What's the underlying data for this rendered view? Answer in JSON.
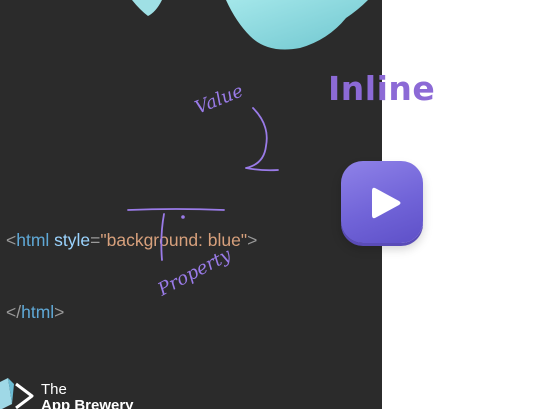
{
  "slide": {
    "title": "Inline",
    "code": {
      "line1": {
        "open_bracket": "<",
        "tag": "html",
        "attr": "style",
        "equals": "=",
        "value": "\"background: blue\"",
        "close_bracket": ">"
      },
      "line2": {
        "open_bracket": "</",
        "tag": "html",
        "close_bracket": ">"
      }
    },
    "annotations": {
      "value_label": "Value",
      "property_label": "Property"
    },
    "colors": {
      "panel_bg": "#2b2b2b",
      "accent": "#8c6ad6",
      "annotation": "#9a7be8",
      "play_button": "#7b6ee0"
    }
  },
  "brand": {
    "line1": "The",
    "line2": "App Brewery"
  },
  "player": {
    "play_icon": "play-icon"
  }
}
